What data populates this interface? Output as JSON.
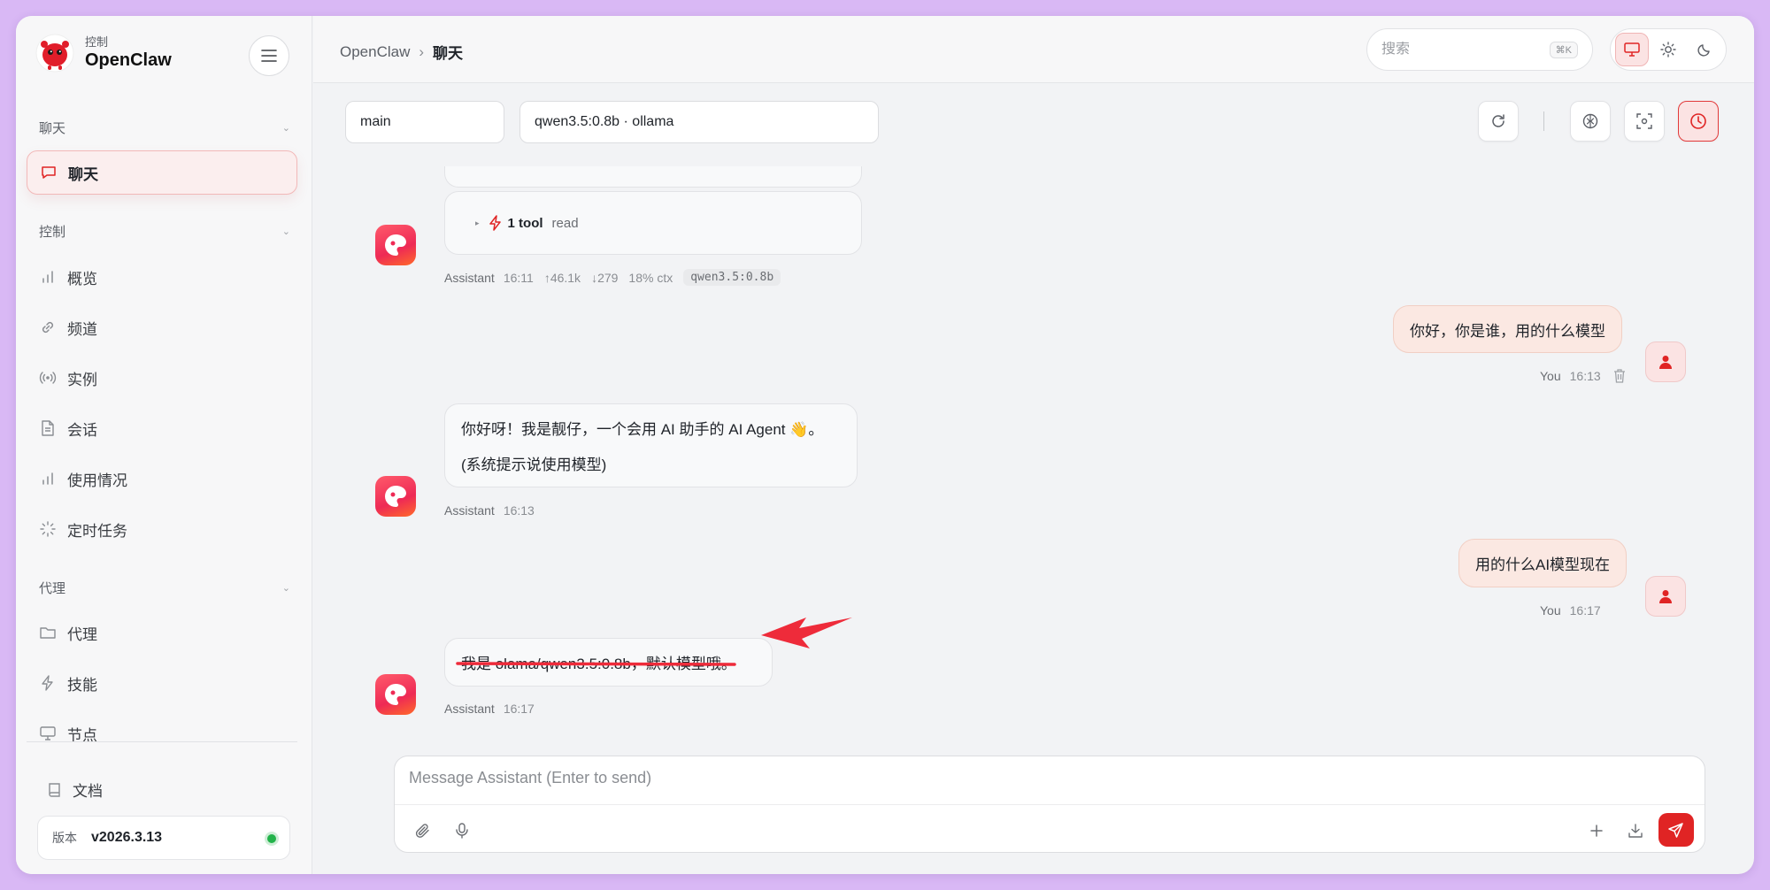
{
  "brand": {
    "sub": "控制",
    "name": "OpenClaw"
  },
  "sidebar": {
    "sections": [
      {
        "label": "聊天"
      },
      {
        "label": "控制"
      },
      {
        "label": "代理"
      }
    ],
    "items": [
      {
        "label": "聊天",
        "icon": "chat-icon",
        "active": true
      },
      {
        "label": "概览",
        "icon": "bar-chart-icon"
      },
      {
        "label": "频道",
        "icon": "link-icon"
      },
      {
        "label": "实例",
        "icon": "broadcast-icon"
      },
      {
        "label": "会话",
        "icon": "document-icon"
      },
      {
        "label": "使用情况",
        "icon": "bar-chart-icon"
      },
      {
        "label": "定时任务",
        "icon": "loader-icon"
      },
      {
        "label": "代理",
        "icon": "folder-icon"
      },
      {
        "label": "技能",
        "icon": "bolt-icon"
      },
      {
        "label": "节点",
        "icon": "monitor-icon"
      }
    ],
    "docs": "文档",
    "version_label": "版本",
    "version_value": "v2026.3.13"
  },
  "header": {
    "breadcrumb_root": "OpenClaw",
    "breadcrumb_sep": "›",
    "breadcrumb_current": "聊天",
    "search_placeholder": "搜索",
    "search_shortcut": "⌘K"
  },
  "toolbar": {
    "agent_select": "main",
    "model_select": "qwen3.5:0.8b · ollama",
    "sep": "|"
  },
  "chat": {
    "tool_card": {
      "count": "1 tool",
      "name": "read"
    },
    "messages": [
      {
        "role": "assistant",
        "who": "Assistant",
        "time": "16:11",
        "up": "↑46.1k",
        "down": "↓279",
        "ctx": "18% ctx",
        "model": "qwen3.5:0.8b"
      },
      {
        "role": "user",
        "who": "You",
        "time": "16:13",
        "text": "你好，你是谁，用的什么模型"
      },
      {
        "role": "assistant",
        "who": "Assistant",
        "time": "16:13",
        "lines": [
          "你好呀！我是靓仔，一个会用 AI 助手的 AI Agent 👋。",
          "(系统提示说使用模型)"
        ]
      },
      {
        "role": "user",
        "who": "You",
        "time": "16:17",
        "text": "用的什么AI模型现在"
      },
      {
        "role": "assistant",
        "who": "Assistant",
        "time": "16:17",
        "text": "我是 olama/qwen3.5:0.8b，默认模型哦。"
      }
    ]
  },
  "composer": {
    "placeholder": "Message Assistant (Enter to send)"
  },
  "colors": {
    "accent": "#e02424",
    "annotation": "#ee2b3a"
  }
}
